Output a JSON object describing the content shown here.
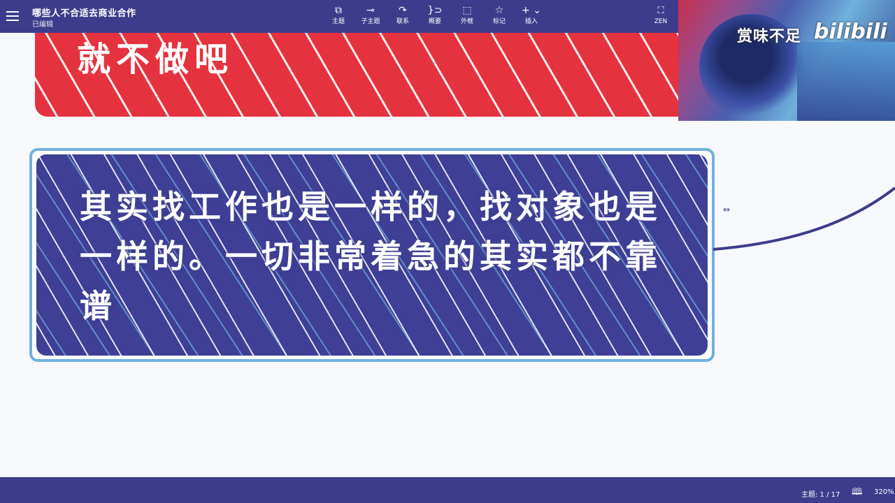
{
  "header": {
    "title": "哪些人不合适去商业合作",
    "status": "已编辑",
    "tools": [
      {
        "icon": "⧉",
        "label": "主题",
        "name": "tool-topic"
      },
      {
        "icon": "⊸",
        "label": "子主题",
        "name": "tool-subtopic"
      },
      {
        "icon": "↷",
        "label": "联系",
        "name": "tool-relation"
      },
      {
        "icon": "}⊃",
        "label": "概要",
        "name": "tool-summary"
      },
      {
        "icon": "⬚",
        "label": "外框",
        "name": "tool-boundary"
      },
      {
        "icon": "☆",
        "label": "标记",
        "name": "tool-marker"
      },
      {
        "icon": "+ ⌄",
        "label": "插入",
        "name": "tool-insert"
      }
    ],
    "fullscreen": {
      "icon": "⛶",
      "label": "ZEN"
    }
  },
  "canvas": {
    "top_card": {
      "text": "就不做吧"
    },
    "main_card": {
      "text": "其实找工作也是一样的，找对象也是一样的。一切非常着急的其实都不靠谱"
    },
    "colors": {
      "card_blue": "#3f3f95",
      "card_red": "#e5323f",
      "border": "#6fb1dc",
      "connector": "#3d3c8c"
    }
  },
  "video_overlay": {
    "caption": "赏味不足",
    "logo": "bilibili"
  },
  "statusbar": {
    "topic_count": "主题: 1 / 17",
    "zoom": "320%"
  },
  "icons": {
    "menu": "menu-icon",
    "outline": "book-icon",
    "resize": "resize-icon"
  }
}
